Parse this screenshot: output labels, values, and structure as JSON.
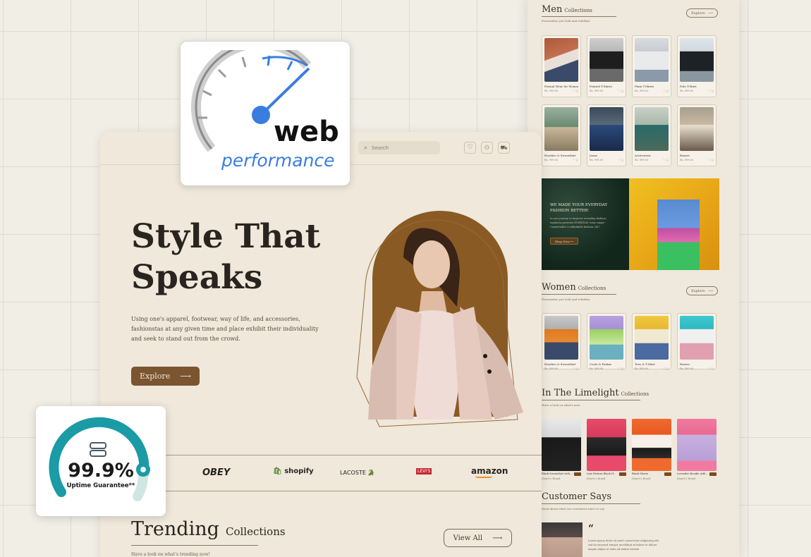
{
  "web_card": {
    "line1": "web",
    "line2": "performance"
  },
  "uptime": {
    "value": "99.9%",
    "label": "Uptime Guarantee**",
    "level_percent": 99.9
  },
  "hero": {
    "search_placeholder": "Search",
    "title_line1": "Style That",
    "title_line2": "Speaks",
    "description_line1": "Using one's apparel, footwear, way of life, and accessories,",
    "description_line2": "fashionstas at any given time and place exhibit their individuality",
    "description_line3": "and seek to stand out from the crowd.",
    "explore_label": "Explore"
  },
  "brands": [
    "OBEY",
    "shopify",
    "LACOSTE",
    "LEVI'S",
    "amazon"
  ],
  "trending": {
    "title": "Trending",
    "suffix": "Collections",
    "view_all": "View All",
    "subtitle": "Have a look on what's trending now!"
  },
  "men": {
    "title": "Men",
    "suffix": "Collections",
    "subtitle": "Personalize you look and redefine",
    "explore": "Explore",
    "products": [
      {
        "name": "Formal Wear for Women",
        "price": "Rs. 999.00"
      },
      {
        "name": "Printed T-Shirts",
        "price": "Rs. 999.00"
      },
      {
        "name": "Plain T-Shirts",
        "price": "Rs. 999.00"
      },
      {
        "name": "Polo T-Shirt",
        "price": "Rs. 999.00"
      },
      {
        "name": "Hoodies & Sweatshirt",
        "price": "Rs. 999.00"
      },
      {
        "name": "Jeans",
        "price": "Rs. 999.00"
      },
      {
        "name": "Activewear",
        "price": "Rs. 999.00"
      },
      {
        "name": "Boxers",
        "price": "Rs. 999.00"
      }
    ]
  },
  "banner": {
    "headline_line1": "WE MADE YOUR EVERYDAY",
    "headline_line2": "FASHION BETTER!",
    "text_line1": "In our journey to improve everyday fashion,",
    "text_line2": "euphoria presents EVERYDAY wear range -",
    "text_line3": "Comfortable & affordable fashion 24/7",
    "button": "Shop Now"
  },
  "women": {
    "title": "Women",
    "suffix": "Collections",
    "subtitle": "Personalize you look and redefine",
    "explore": "Explore",
    "products": [
      {
        "name": "Hoodies & Sweatshirt",
        "price": "Rs. 999.00"
      },
      {
        "name": "Coats & Parkas",
        "price": "Rs. 999.00"
      },
      {
        "name": "Tees & T-Shirt",
        "price": "Rs. 999.00"
      },
      {
        "name": "Boxers",
        "price": "Rs. 999.00"
      }
    ]
  },
  "limelight": {
    "title": "In The Limelight",
    "suffix": "Collections",
    "subtitle": "Have a look on what's new",
    "products": [
      {
        "name": "Black Sweatshirt with...",
        "brand": "Jhanvi's Brand"
      },
      {
        "name": "Line Pattern Black H...",
        "brand": "Jhanvi's Brand"
      },
      {
        "name": "Black Shorts",
        "brand": "Jhanvi's Brand"
      },
      {
        "name": "Levender Hoodie with...",
        "brand": "Jhanvi's Brand"
      }
    ]
  },
  "customer": {
    "title": "Customer Says",
    "subtitle": "Read about what our customers have to say",
    "quote_line1": "Lorem ipsum dolor sit amet consectetur adipiscing elit",
    "quote_line2": "sed do eiusmod tempor incididunt ut labore et dolore",
    "quote_line3": "magna aliqua ut enim ad minim veniam"
  },
  "colors": {
    "accent": "#7a5530",
    "arch": "#8a5a24",
    "background": "#efe8db",
    "gauge": "#1a9ba5",
    "speed_blue": "#3a7de0"
  }
}
